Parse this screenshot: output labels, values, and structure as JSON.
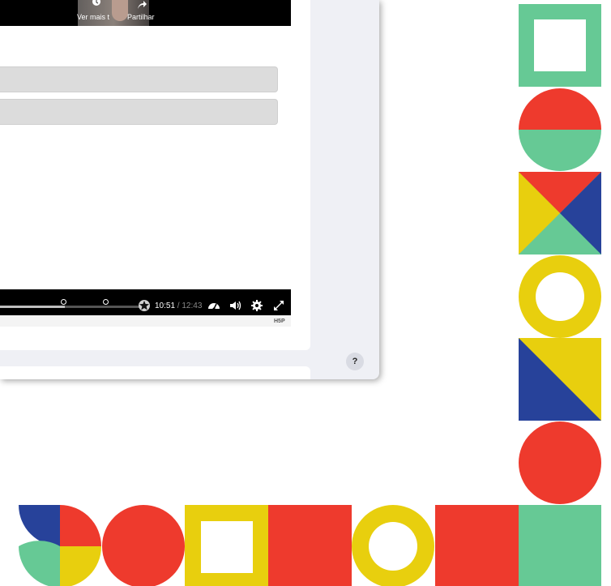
{
  "video": {
    "watch_more_label": "Ver mais t",
    "share_label": "Partilhar"
  },
  "player": {
    "current_time": "10:51",
    "separator": " / ",
    "duration": "12:43",
    "progress_fraction": 0.854,
    "logo": "H5P"
  },
  "help": {
    "label": "?"
  },
  "answers": [
    {
      "label": ""
    },
    {
      "label": ""
    }
  ],
  "icons": [
    "clock-icon",
    "share-icon",
    "playback-rate-icon",
    "volume-icon",
    "settings-icon",
    "fullscreen-icon",
    "bookmark-star-icon"
  ],
  "colors": {
    "green": "#66c995",
    "red": "#ee3a2d",
    "yellow": "#e8cf0e",
    "blue": "#27429a",
    "modal_bg": "#eff0f5"
  }
}
